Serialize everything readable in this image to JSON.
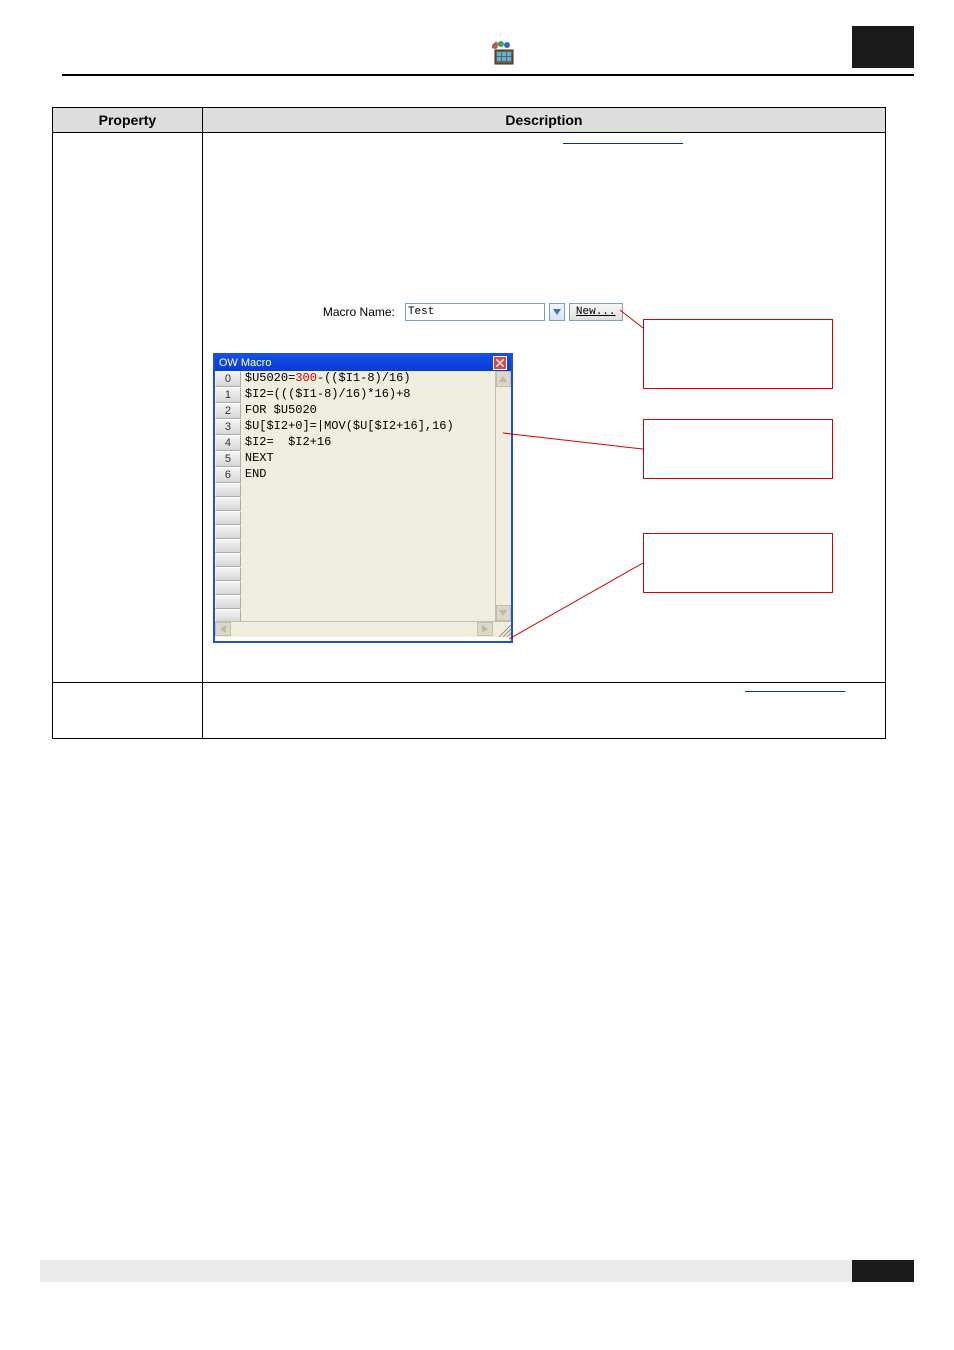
{
  "header": {
    "top_divider": true
  },
  "table": {
    "headers": {
      "property": "Property",
      "description": "Description"
    },
    "row1": {
      "link_top": " ",
      "macro_name_label": "Macro Name:",
      "macro_name_value": "Test",
      "new_button": "New...",
      "ow_title": "OW Macro",
      "code": [
        {
          "n": "0",
          "text": "$U5020=300-(($I1-8)/16)"
        },
        {
          "n": "1",
          "text": "$I2=((($I1-8)/16)*16)+8"
        },
        {
          "n": "2",
          "text": "FOR $U5020"
        },
        {
          "n": "3",
          "text": "$U[$I2+0]=|MOV($U[$I2+16],16)"
        },
        {
          "n": "4",
          "text": "$I2=  $I2+16"
        },
        {
          "n": "5",
          "text": "NEXT"
        },
        {
          "n": "6",
          "text": "END"
        }
      ],
      "annotations": {
        "a1": " ",
        "a2": " ",
        "a3": " "
      }
    },
    "row2": {
      "link": " "
    }
  }
}
